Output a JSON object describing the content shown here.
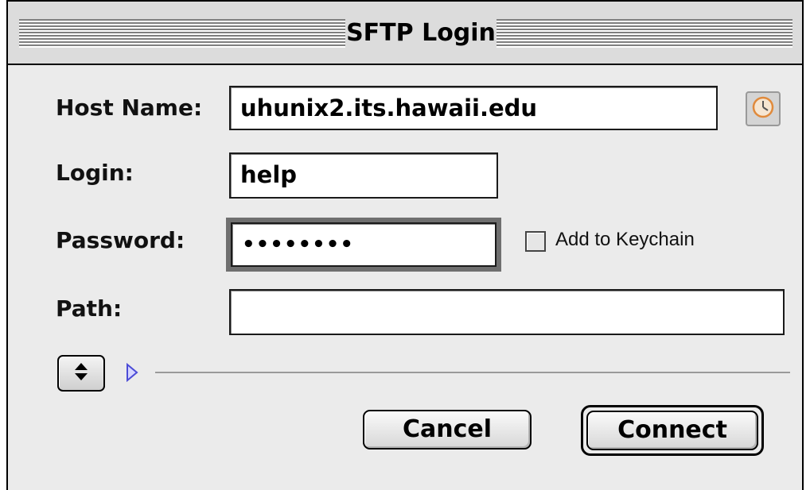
{
  "window": {
    "title": "SFTP Login"
  },
  "form": {
    "host_label": "Host Name:",
    "host_value": "uhunix2.its.hawaii.edu",
    "login_label": "Login:",
    "login_value": "help",
    "password_label": "Password:",
    "password_value": "••••••••",
    "path_label": "Path:",
    "path_value": "",
    "keychain_label": "Add to Keychain",
    "keychain_checked": false
  },
  "buttons": {
    "cancel_label": "Cancel",
    "connect_label": "Connect"
  },
  "icons": {
    "history": "clock-icon",
    "stepper": "up-down-arrows-icon",
    "disclosure": "disclosure-triangle-icon"
  },
  "colors": {
    "window_background": "#ebebeb",
    "disclosure_triangle": "#4b4bd6",
    "history_clock": "#e08a3c"
  }
}
